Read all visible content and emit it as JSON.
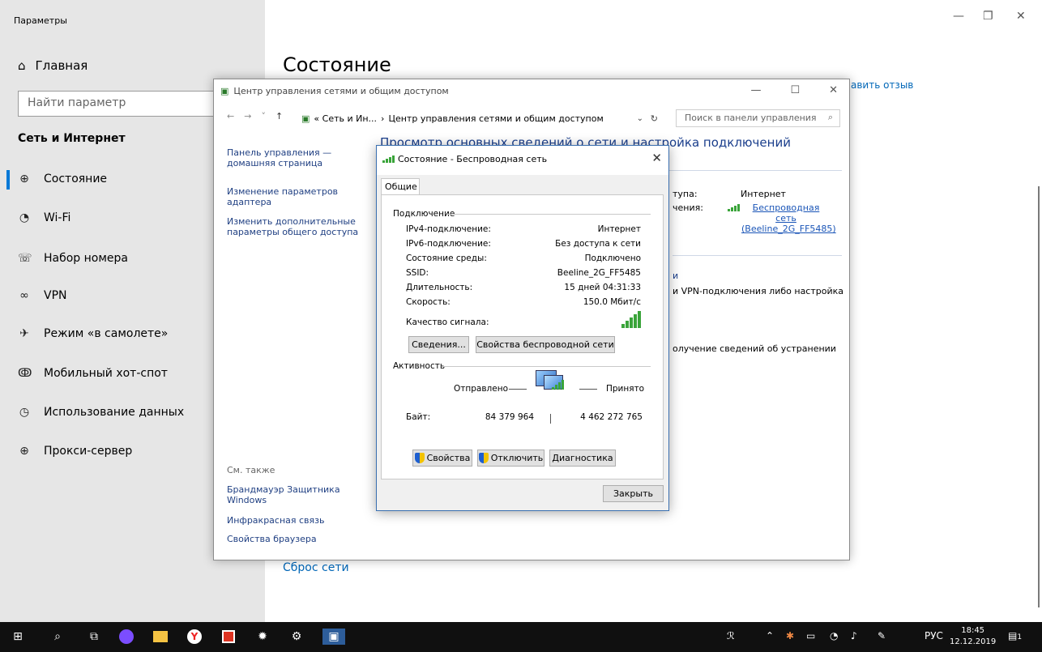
{
  "settings": {
    "window_title": "Параметры",
    "home_label": "Главная",
    "search_placeholder": "Найти параметр",
    "section_title": "Сеть и Интернет",
    "nav": [
      {
        "label": "Состояние",
        "icon": "globe-status-icon"
      },
      {
        "label": "Wi-Fi",
        "icon": "wifi-icon"
      },
      {
        "label": "Набор номера",
        "icon": "dialup-icon"
      },
      {
        "label": "VPN",
        "icon": "vpn-icon"
      },
      {
        "label": "Режим «в самолете»",
        "icon": "airplane-icon"
      },
      {
        "label": "Мобильный хот-спот",
        "icon": "hotspot-icon"
      },
      {
        "label": "Использование данных",
        "icon": "data-usage-icon"
      },
      {
        "label": "Прокси-сервер",
        "icon": "proxy-icon"
      }
    ],
    "page_title": "Состояние",
    "feedback_link": "авить отзыв",
    "reset_link": "Сброс сети"
  },
  "control_panel": {
    "title": "Центр управления сетями и общим доступом",
    "breadcrumb_1": "« Сеть и Ин...",
    "breadcrumb_sep": "›",
    "breadcrumb_2": "Центр управления сетями и общим доступом",
    "search_placeholder": "Поиск в панели управления",
    "home_link": "Панель управления — домашняя страница",
    "adapter_link": "Изменение параметров адаптера",
    "sharing_link": "Изменить дополнительные параметры общего доступа",
    "heading": "Просмотр основных сведений о сети и настройка подключений",
    "access_label": "тупа:",
    "access_value": "Интернет",
    "conn_label": "чения:",
    "conn_value": "Беспроводная сеть (Beeline_2G_FF5485)",
    "task_1": "и",
    "task_2": "и VPN-подключения либо настройка",
    "task_3": "олучение сведений об устранении",
    "see_also": "См. также",
    "see_also_items": [
      "Брандмауэр Защитника Windows",
      "Инфракрасная связь",
      "Свойства браузера"
    ]
  },
  "dialog": {
    "title": "Состояние - Беспроводная сеть",
    "tab": "Общие",
    "connection_group": "Подключение",
    "rows": [
      {
        "label": "IPv4-подключение:",
        "value": "Интернет"
      },
      {
        "label": "IPv6-подключение:",
        "value": "Без доступа к сети"
      },
      {
        "label": "Состояние среды:",
        "value": "Подключено"
      },
      {
        "label": "SSID:",
        "value": "Beeline_2G_FF5485"
      },
      {
        "label": "Длительность:",
        "value": "15 дней 04:31:33"
      },
      {
        "label": "Скорость:",
        "value": "150.0 Мбит/с"
      }
    ],
    "signal_label": "Качество сигнала:",
    "details_button": "Сведения...",
    "wireless_props_button": "Свойства беспроводной сети",
    "activity_group": "Активность",
    "sent_label": "Отправлено",
    "received_label": "Принято",
    "bytes_label": "Байт:",
    "bytes_sent": "84 379 964",
    "bytes_received": "4 462 272 765",
    "properties_button": "Свойства",
    "disable_button": "Отключить",
    "diagnose_button": "Диагностика",
    "close_button": "Закрыть"
  },
  "taskbar": {
    "lang": "РУС",
    "time": "18:45",
    "date": "12.12.2019",
    "notification_count": "1"
  }
}
